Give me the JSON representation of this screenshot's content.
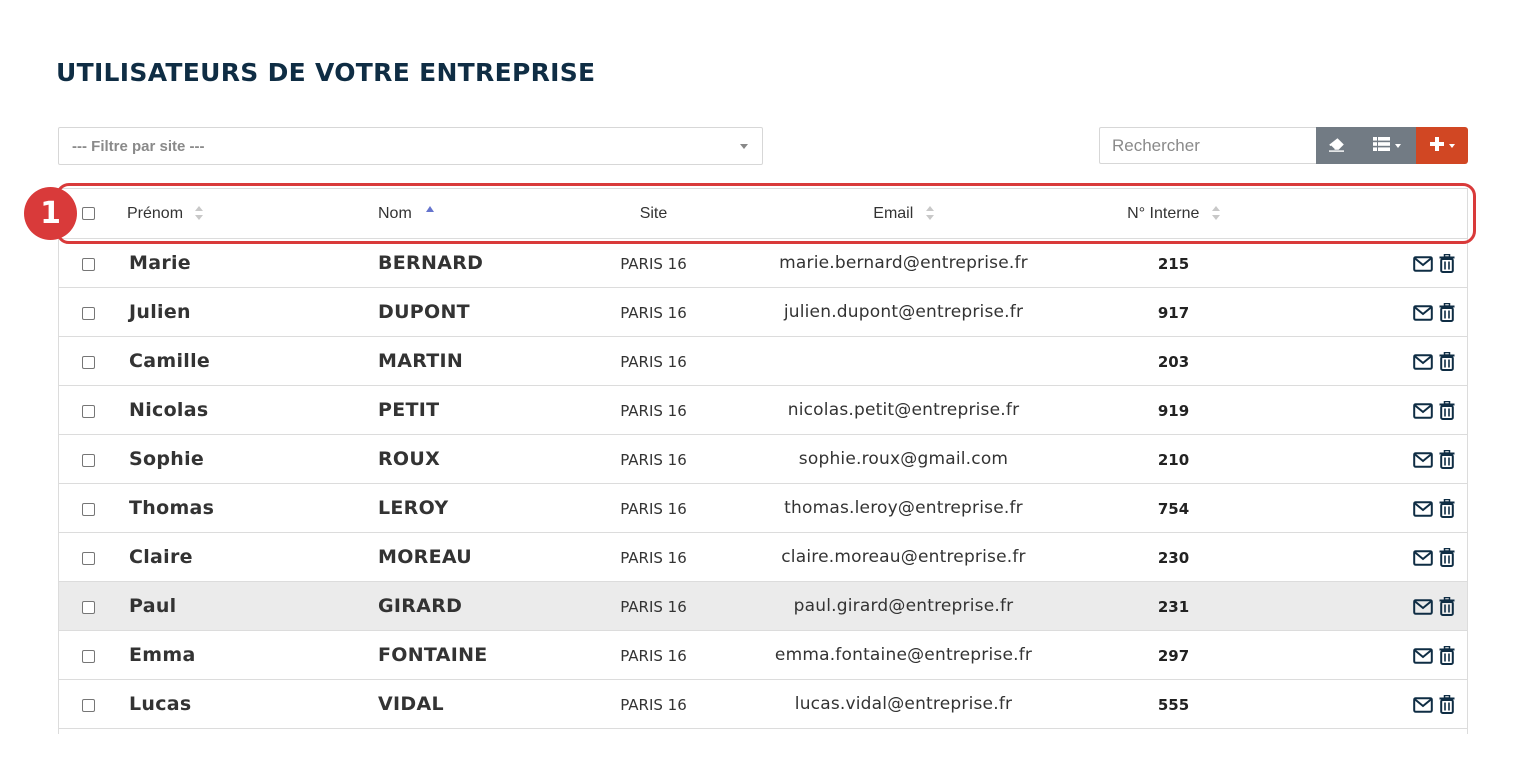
{
  "page": {
    "title": "UTILISATEURS DE VOTRE ENTREPRISE"
  },
  "filter": {
    "placeholder": "--- Filtre par site ---"
  },
  "search": {
    "placeholder": "Rechercher"
  },
  "toolbar": {
    "clear_icon": "eraser-icon",
    "columns_icon": "list-columns-icon",
    "add_icon": "plus-icon",
    "add_color": "#d14723",
    "secondary_color": "#727b84"
  },
  "table": {
    "columns": {
      "prenom": "Prénom",
      "nom": "Nom",
      "site": "Site",
      "email": "Email",
      "interne": "N° Interne"
    },
    "sorted_by": "nom",
    "sort_direction": "asc",
    "rows": [
      {
        "prenom": "Marie",
        "nom": "BERNARD",
        "site": "PARIS 16",
        "email": "marie.bernard@entreprise.fr",
        "interne": "215"
      },
      {
        "prenom": "Julien",
        "nom": "DUPONT",
        "site": "PARIS 16",
        "email": "julien.dupont@entreprise.fr",
        "interne": "917"
      },
      {
        "prenom": "Camille",
        "nom": "MARTIN",
        "site": "PARIS 16",
        "email": "",
        "interne": "203"
      },
      {
        "prenom": "Nicolas",
        "nom": "PETIT",
        "site": "PARIS 16",
        "email": "nicolas.petit@entreprise.fr",
        "interne": "919"
      },
      {
        "prenom": "Sophie",
        "nom": "ROUX",
        "site": "PARIS 16",
        "email": "sophie.roux@gmail.com",
        "interne": "210"
      },
      {
        "prenom": "Thomas",
        "nom": "LEROY",
        "site": "PARIS 16",
        "email": "thomas.leroy@entreprise.fr",
        "interne": "754"
      },
      {
        "prenom": "Claire",
        "nom": "MOREAU",
        "site": "PARIS 16",
        "email": "claire.moreau@entreprise.fr",
        "interne": "230"
      },
      {
        "prenom": "Paul",
        "nom": "GIRARD",
        "site": "PARIS 16",
        "email": "paul.girard@entreprise.fr",
        "interne": "231",
        "highlighted": true
      },
      {
        "prenom": "Emma",
        "nom": "FONTAINE",
        "site": "PARIS 16",
        "email": "emma.fontaine@entreprise.fr",
        "interne": "297"
      },
      {
        "prenom": "Lucas",
        "nom": "VIDAL",
        "site": "PARIS 16",
        "email": "lucas.vidal@entreprise.fr",
        "interne": "555"
      }
    ],
    "row_action_icons": [
      "envelope-icon",
      "trash-icon"
    ],
    "highlight_color": "#ebebeb"
  },
  "annotation": {
    "badge": "1",
    "color": "#d93a3a"
  }
}
